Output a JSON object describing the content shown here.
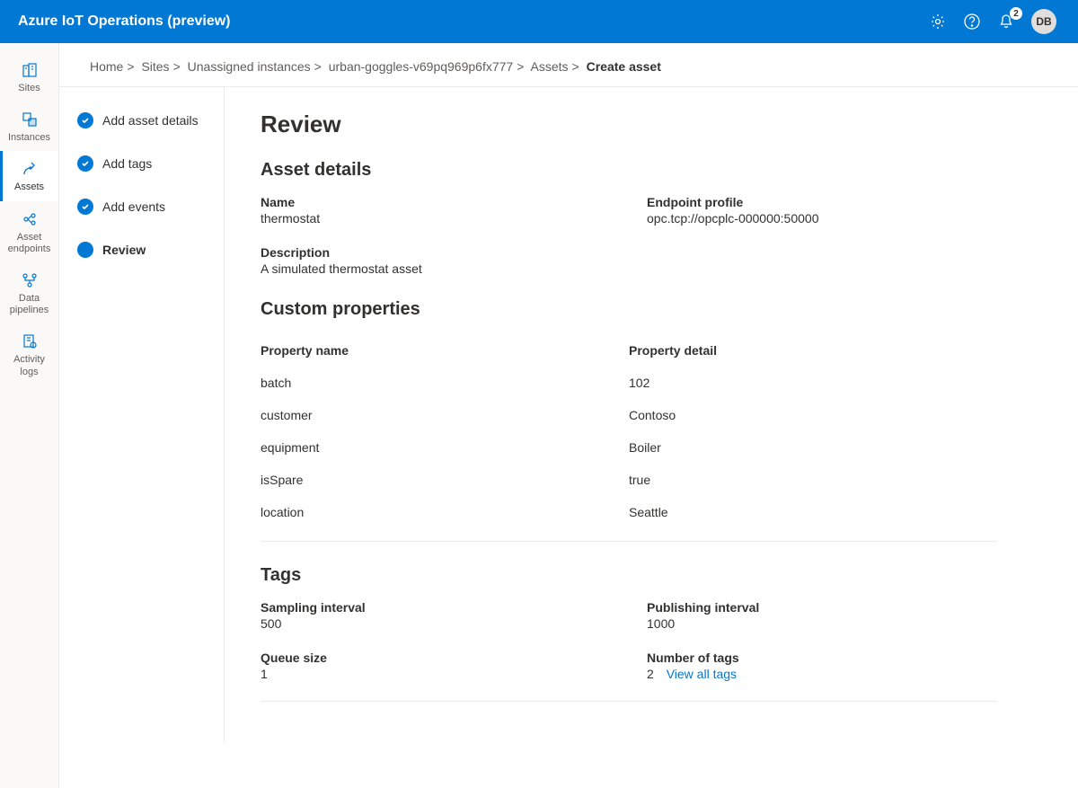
{
  "topbar": {
    "title": "Azure IoT Operations (preview)",
    "notification_count": "2",
    "avatar_initials": "DB"
  },
  "sidenav": {
    "items": [
      {
        "label": "Sites",
        "icon": "sites"
      },
      {
        "label": "Instances",
        "icon": "instances"
      },
      {
        "label": "Assets",
        "icon": "assets"
      },
      {
        "label": "Asset endpoints",
        "icon": "endpoints"
      },
      {
        "label": "Data pipelines",
        "icon": "pipelines"
      },
      {
        "label": "Activity logs",
        "icon": "logs"
      }
    ]
  },
  "breadcrumb": {
    "items": [
      "Home",
      "Sites",
      "Unassigned instances",
      "urban-goggles-v69pq969p6fx777",
      "Assets"
    ],
    "current": "Create asset"
  },
  "steps": {
    "items": [
      {
        "label": "Add asset details",
        "done": true
      },
      {
        "label": "Add tags",
        "done": true
      },
      {
        "label": "Add events",
        "done": true
      },
      {
        "label": "Review",
        "done": false,
        "current": true
      }
    ]
  },
  "review": {
    "title": "Review",
    "asset_details": {
      "heading": "Asset details",
      "name_label": "Name",
      "name_value": "thermostat",
      "endpoint_label": "Endpoint profile",
      "endpoint_value": "opc.tcp://opcplc-000000:50000",
      "description_label": "Description",
      "description_value": "A simulated thermostat asset"
    },
    "custom": {
      "heading": "Custom properties",
      "col_name": "Property name",
      "col_detail": "Property detail",
      "rows": [
        {
          "name": "batch",
          "detail": "102"
        },
        {
          "name": "customer",
          "detail": "Contoso"
        },
        {
          "name": "equipment",
          "detail": "Boiler"
        },
        {
          "name": "isSpare",
          "detail": "true"
        },
        {
          "name": "location",
          "detail": "Seattle"
        }
      ]
    },
    "tags": {
      "heading": "Tags",
      "sampling_label": "Sampling interval",
      "sampling_value": "500",
      "publishing_label": "Publishing interval",
      "publishing_value": "1000",
      "queue_label": "Queue size",
      "queue_value": "1",
      "count_label": "Number of tags",
      "count_value": "2",
      "view_all": "View all tags"
    }
  }
}
